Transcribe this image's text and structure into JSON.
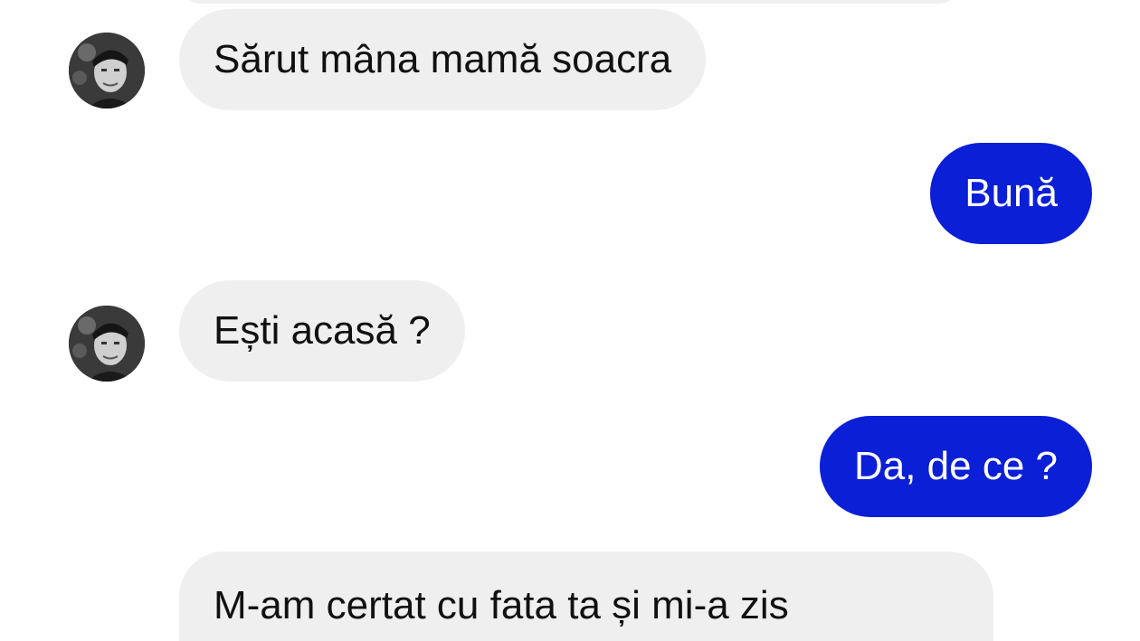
{
  "colors": {
    "incoming_bubble": "#efefef",
    "outgoing_bubble": "#0a1fd6",
    "incoming_text": "#111111",
    "outgoing_text": "#ffffff",
    "background": "#ffffff"
  },
  "messages": [
    {
      "direction": "incoming",
      "text": "Sărut mâna mamă soacra"
    },
    {
      "direction": "outgoing",
      "text": "Bună"
    },
    {
      "direction": "incoming",
      "text": "Ești acasă ?"
    },
    {
      "direction": "outgoing",
      "text": "Da, de ce ?"
    },
    {
      "direction": "incoming",
      "text": "M-am certat cu fata ta și mi-a zis"
    }
  ]
}
